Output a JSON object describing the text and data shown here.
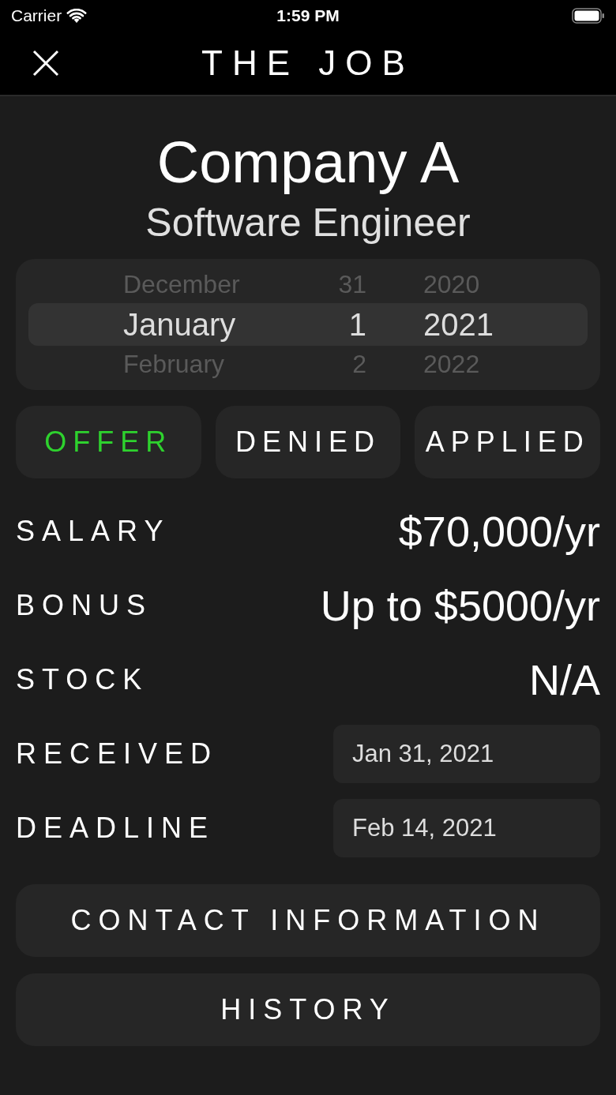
{
  "status_bar": {
    "carrier": "Carrier",
    "time": "1:59 PM"
  },
  "nav": {
    "title": "THE JOB"
  },
  "company": "Company A",
  "position": "Software Engineer",
  "date_picker": {
    "rows": [
      {
        "month": "December",
        "day": "31",
        "year": "2020",
        "selected": false
      },
      {
        "month": "January",
        "day": "1",
        "year": "2021",
        "selected": true
      },
      {
        "month": "February",
        "day": "2",
        "year": "2022",
        "selected": false
      }
    ]
  },
  "status_options": [
    {
      "label": "OFFER",
      "selected": true
    },
    {
      "label": "DENIED",
      "selected": false
    },
    {
      "label": "APPLIED",
      "selected": false
    }
  ],
  "details": [
    {
      "kind": "text",
      "label": "SALARY",
      "value": "$70,000/yr"
    },
    {
      "kind": "text",
      "label": "BONUS",
      "value": "Up to $5000/yr"
    },
    {
      "kind": "text",
      "label": "STOCK",
      "value": "N/A"
    },
    {
      "kind": "date",
      "label": "RECEIVED",
      "value": "Jan 31, 2021"
    },
    {
      "kind": "date",
      "label": "DEADLINE",
      "value": "Feb 14, 2021"
    }
  ],
  "buttons": [
    "CONTACT INFORMATION",
    "HISTORY"
  ]
}
